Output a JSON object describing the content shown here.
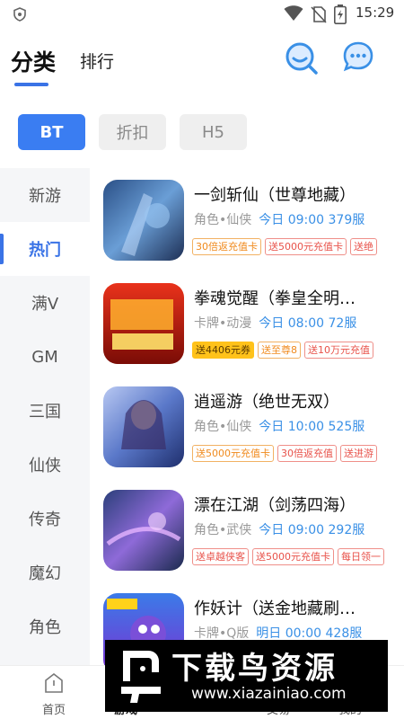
{
  "status_bar": {
    "time": "15:29"
  },
  "header": {
    "tab_active": "分类",
    "tab_other": "排行"
  },
  "chips": [
    "BT",
    "折扣",
    "H5"
  ],
  "categories": [
    "新游",
    "热门",
    "满V",
    "GM",
    "三国",
    "仙侠",
    "传奇",
    "魔幻",
    "角色"
  ],
  "active_category": "热门",
  "games": [
    {
      "title": "一剑斩仙（世尊地藏）",
      "genre": "角色•仙侠",
      "server": "今日 09:00 379服",
      "tags": [
        {
          "text": "30倍返充值卡",
          "style": "orange"
        },
        {
          "text": "送5000元充值卡",
          "style": "red"
        },
        {
          "text": "送绝",
          "style": "red"
        }
      ]
    },
    {
      "title": "拳魂觉醒（拳皇全明…",
      "genre": "卡牌•动漫",
      "server": "今日 08:00 72服",
      "tags": [
        {
          "text": "送4406元券",
          "style": "yellow"
        },
        {
          "text": "送至尊8",
          "style": "orange"
        },
        {
          "text": "送10万元充值",
          "style": "red"
        }
      ]
    },
    {
      "title": "逍遥游（绝世无双）",
      "genre": "角色•仙侠",
      "server": "今日 10:00 525服",
      "tags": [
        {
          "text": "送5000元充值卡",
          "style": "orange"
        },
        {
          "text": "30倍返充值",
          "style": "red"
        },
        {
          "text": "送进游",
          "style": "red"
        }
      ]
    },
    {
      "title": "漂在江湖（剑荡四海）",
      "genre": "角色•武侠",
      "server": "今日 09:00 292服",
      "tags": [
        {
          "text": "送卓越侠客",
          "style": "red"
        },
        {
          "text": "送5000元充值卡",
          "style": "red"
        },
        {
          "text": "每日领一",
          "style": "red"
        }
      ]
    },
    {
      "title": "作妖计（送金地藏刷…",
      "genre": "卡牌•Q版",
      "server": "明日 00:00 428服",
      "tags": []
    }
  ],
  "bottom_nav": [
    "首页",
    "游戏",
    "交易",
    "我的"
  ],
  "watermark": {
    "title": "下载鸟资源",
    "url": "www.xiazainiao.com"
  },
  "colors": {
    "accent": "#3a73e6",
    "chip_active": "#3a7df2",
    "server_text": "#3a90e6",
    "tag_orange": "#f08a1d",
    "tag_red": "#e8524a",
    "tag_yellow": "#ffc21a"
  }
}
